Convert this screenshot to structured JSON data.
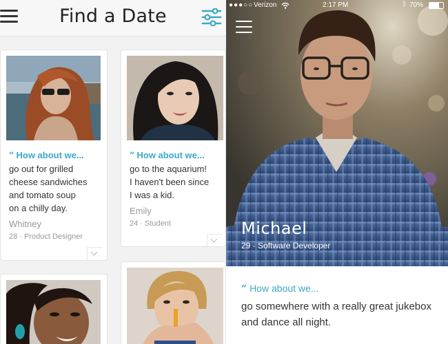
{
  "left_screen": {
    "title": "Find a Date",
    "cards": [
      {
        "prompt": "How about we...",
        "text": [
          "go out for grilled",
          "cheese sandwiches",
          "and tomato soup",
          "on a chilly day."
        ],
        "name": "Whitney",
        "details": "28 · Product Designer"
      },
      {
        "prompt": "How about we...",
        "text": [
          "go to the aquarium!",
          "I haven't been since",
          "I was a kid."
        ],
        "name": "Emily",
        "details": "24 · Student"
      }
    ]
  },
  "right_screen": {
    "status": {
      "carrier": "Verizon",
      "time": "2:17 PM",
      "battery": "70%"
    },
    "profile": {
      "name": "Michael",
      "details": "29 · Software Developer"
    },
    "prompt": "How about we...",
    "text": "go somewhere with a really great jukebox and dance all night."
  },
  "colors": {
    "accent": "#3aa9c7",
    "text": "#333333",
    "muted": "#999999"
  },
  "icons": [
    "menu-icon",
    "filter-sliders-icon",
    "chevron-down-icon",
    "wifi-icon",
    "bluetooth-icon",
    "battery-icon",
    "quote-icon"
  ]
}
